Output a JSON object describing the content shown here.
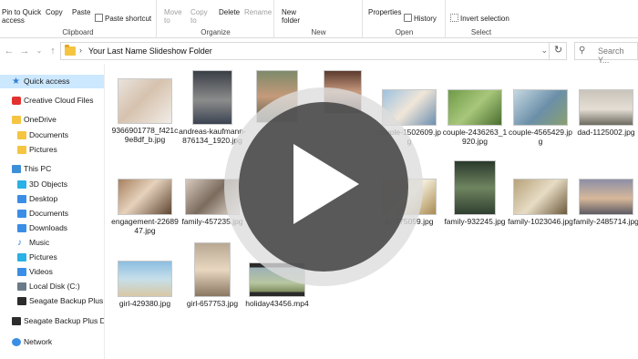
{
  "ribbon": {
    "pin_label": "Pin to Quick access",
    "copy_label": "Copy",
    "paste_label": "Paste",
    "paste_shortcut_label": "Paste shortcut",
    "clipboard_group": "Clipboard",
    "move_to_label": "Move to",
    "copy_to_label": "Copy to",
    "delete_label": "Delete",
    "rename_label": "Rename",
    "organize_group": "Organize",
    "new_folder_label": "New folder",
    "new_group": "New",
    "properties_label": "Properties",
    "history_label": "History",
    "open_group": "Open",
    "invert_selection_label": "Invert selection",
    "select_group": "Select"
  },
  "address": {
    "path": "Your Last Name Slideshow Folder",
    "search_placeholder": "Search Y..."
  },
  "sidebar": {
    "items": [
      {
        "label": "Quick access",
        "icon": "star-icon",
        "active": true
      },
      {
        "label": "Creative Cloud Files",
        "icon": "creative-cloud-icon"
      },
      {
        "label": "OneDrive",
        "icon": "onedrive-folder-icon"
      },
      {
        "label": "Documents",
        "icon": "folder-icon"
      },
      {
        "label": "Pictures",
        "icon": "folder-icon"
      },
      {
        "label": "This PC",
        "icon": "computer-icon"
      },
      {
        "label": "3D Objects",
        "icon": "3d-objects-icon"
      },
      {
        "label": "Desktop",
        "icon": "desktop-icon"
      },
      {
        "label": "Documents",
        "icon": "documents-icon"
      },
      {
        "label": "Downloads",
        "icon": "downloads-icon"
      },
      {
        "label": "Music",
        "icon": "music-icon"
      },
      {
        "label": "Pictures",
        "icon": "pictures-icon"
      },
      {
        "label": "Videos",
        "icon": "videos-icon"
      },
      {
        "label": "Local Disk (C:)",
        "icon": "disk-icon"
      },
      {
        "label": "Seagate Backup Plus D",
        "icon": "drive-icon"
      },
      {
        "label": "Seagate Backup Plus Driv",
        "icon": "drive-icon"
      },
      {
        "label": "Network",
        "icon": "network-icon"
      }
    ]
  },
  "files": [
    {
      "name": "9366901778_f421c9e8df_b.jpg"
    },
    {
      "name": "andreas-kaufmann-876134_1920.jpg"
    },
    {
      "name": ""
    },
    {
      "name": ""
    },
    {
      "name": "couple-1502609.jpg"
    },
    {
      "name": "couple-2436263_1920.jpg"
    },
    {
      "name": "couple-4565429.jpg"
    },
    {
      "name": "dad-1125002.jpg"
    },
    {
      "name": "engagement-2268947.jpg"
    },
    {
      "name": "family-457235.jpg"
    },
    {
      "name": "ily-775059.jpg"
    },
    {
      "name": "family-932245.jpg"
    },
    {
      "name": "family-1023046.jpg"
    },
    {
      "name": "family-2485714.jpg"
    },
    {
      "name": "girl-429380.jpg"
    },
    {
      "name": "girl-657753.jpg"
    },
    {
      "name": "holiday43456.mp4"
    }
  ],
  "colors": {
    "accent": "#cce8ff",
    "folder": "#f5c542"
  }
}
